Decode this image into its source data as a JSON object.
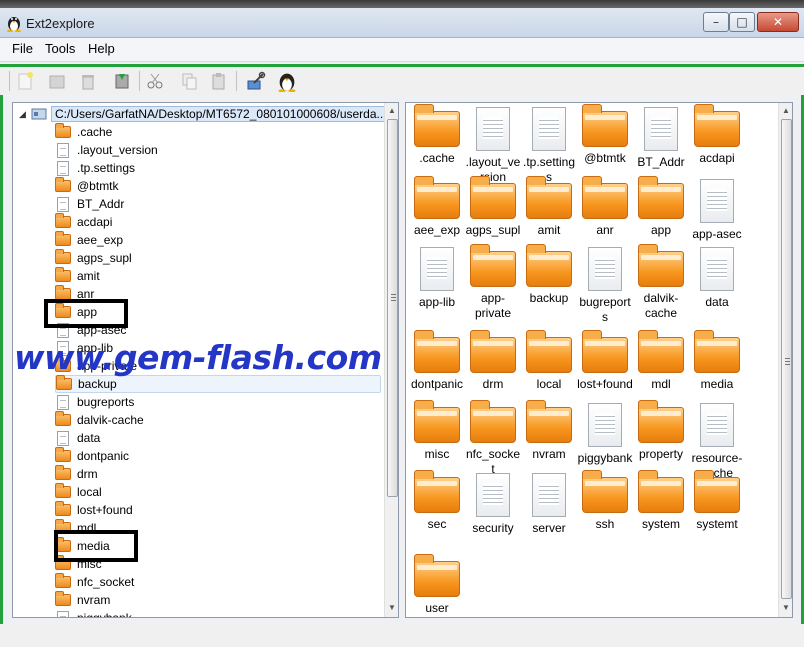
{
  "window": {
    "title": "Ext2explore",
    "minimize": "–",
    "maximize": "□",
    "close": "✕"
  },
  "menu": [
    "File",
    "Tools",
    "Help"
  ],
  "toolbar": [
    "new-file-icon",
    "open-icon",
    "delete-icon",
    "save-icon",
    "cut-icon",
    "copy-icon",
    "paste-icon",
    "tools-icon",
    "linux-penguin-icon"
  ],
  "tree": {
    "root_path": "C:/Users/GarfatNA/Desktop/MT6572_080101000608/userda...",
    "items": [
      {
        "label": ".cache",
        "type": "folder"
      },
      {
        "label": ".layout_version",
        "type": "file"
      },
      {
        "label": ".tp.settings",
        "type": "file"
      },
      {
        "label": "@btmtk",
        "type": "folder"
      },
      {
        "label": "BT_Addr",
        "type": "file"
      },
      {
        "label": "acdapi",
        "type": "folder"
      },
      {
        "label": "aee_exp",
        "type": "folder"
      },
      {
        "label": "agps_supl",
        "type": "folder"
      },
      {
        "label": "amit",
        "type": "folder"
      },
      {
        "label": "anr",
        "type": "folder"
      },
      {
        "label": "app",
        "type": "folder"
      },
      {
        "label": "app-asec",
        "type": "file"
      },
      {
        "label": "app-lib",
        "type": "file"
      },
      {
        "label": "app-private",
        "type": "folder"
      },
      {
        "label": "backup",
        "type": "folder"
      },
      {
        "label": "bugreports",
        "type": "file"
      },
      {
        "label": "dalvik-cache",
        "type": "folder"
      },
      {
        "label": "data",
        "type": "file"
      },
      {
        "label": "dontpanic",
        "type": "folder"
      },
      {
        "label": "drm",
        "type": "folder"
      },
      {
        "label": "local",
        "type": "folder"
      },
      {
        "label": "lost+found",
        "type": "folder"
      },
      {
        "label": "mdl",
        "type": "folder"
      },
      {
        "label": "media",
        "type": "folder"
      },
      {
        "label": "misc",
        "type": "folder"
      },
      {
        "label": "nfc_socket",
        "type": "folder"
      },
      {
        "label": "nvram",
        "type": "folder"
      },
      {
        "label": "piggybank",
        "type": "file"
      }
    ]
  },
  "files": [
    {
      "label": ".cache",
      "type": "folder"
    },
    {
      "label": ".layout_version",
      "type": "file"
    },
    {
      "label": ".tp.settings",
      "type": "file"
    },
    {
      "label": "@btmtk",
      "type": "folder"
    },
    {
      "label": "BT_Addr",
      "type": "file"
    },
    {
      "label": "acdapi",
      "type": "folder"
    },
    {
      "label": "aee_exp",
      "type": "folder"
    },
    {
      "label": "agps_supl",
      "type": "folder"
    },
    {
      "label": "amit",
      "type": "folder"
    },
    {
      "label": "anr",
      "type": "folder"
    },
    {
      "label": "app",
      "type": "folder"
    },
    {
      "label": "app-asec",
      "type": "file"
    },
    {
      "label": "app-lib",
      "type": "file"
    },
    {
      "label": "app-private",
      "type": "folder"
    },
    {
      "label": "backup",
      "type": "folder"
    },
    {
      "label": "bugreports",
      "type": "file"
    },
    {
      "label": "dalvik-cache",
      "type": "folder"
    },
    {
      "label": "data",
      "type": "file"
    },
    {
      "label": "dontpanic",
      "type": "folder"
    },
    {
      "label": "drm",
      "type": "folder"
    },
    {
      "label": "local",
      "type": "folder"
    },
    {
      "label": "lost+found",
      "type": "folder"
    },
    {
      "label": "mdl",
      "type": "folder"
    },
    {
      "label": "media",
      "type": "folder"
    },
    {
      "label": "misc",
      "type": "folder"
    },
    {
      "label": "nfc_socket",
      "type": "folder"
    },
    {
      "label": "nvram",
      "type": "folder"
    },
    {
      "label": "piggybank",
      "type": "file"
    },
    {
      "label": "property",
      "type": "folder"
    },
    {
      "label": "resource-cache",
      "type": "file"
    },
    {
      "label": "sec",
      "type": "folder"
    },
    {
      "label": "security",
      "type": "file"
    },
    {
      "label": "server",
      "type": "file"
    },
    {
      "label": "ssh",
      "type": "folder"
    },
    {
      "label": "system",
      "type": "folder"
    },
    {
      "label": "systemt",
      "type": "folder"
    },
    {
      "label": "user",
      "type": "folder"
    }
  ],
  "watermark": "www.gem-flash.com",
  "colors": {
    "accent_green": "#22a23a",
    "folder_orange": "#f7961e",
    "watermark_blue": "#2436c6"
  }
}
